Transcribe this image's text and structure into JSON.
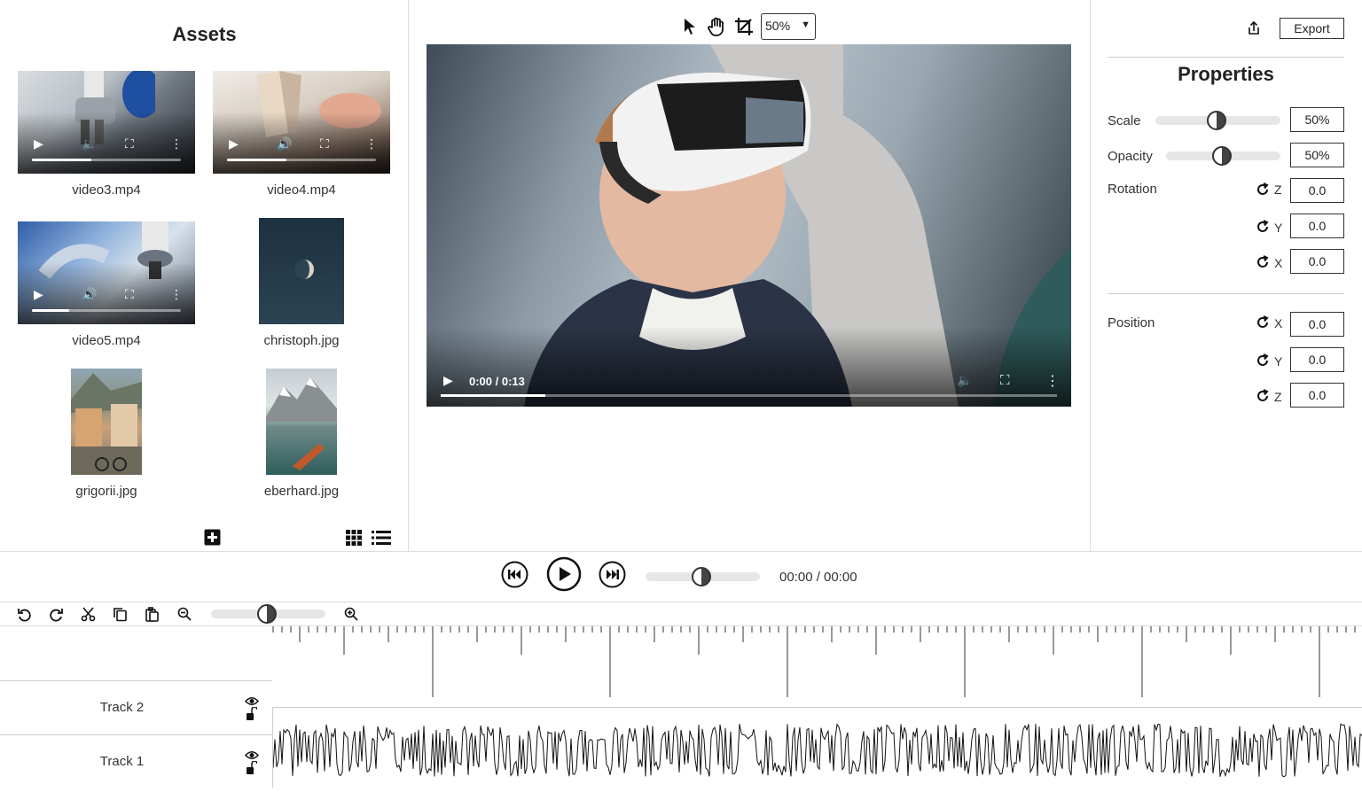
{
  "assets": {
    "title": "Assets",
    "items": [
      {
        "name": "video3.mp4",
        "type": "video",
        "progress": 0.4
      },
      {
        "name": "video4.mp4",
        "type": "video",
        "progress": 0.4
      },
      {
        "name": "video5.mp4",
        "type": "video",
        "progress": 0.25
      },
      {
        "name": "christoph.jpg",
        "type": "image"
      },
      {
        "name": "grigorii.jpg",
        "type": "image"
      },
      {
        "name": "eberhard.jpg",
        "type": "image"
      }
    ],
    "icons": {
      "add": "plus-square-icon",
      "grid": "grid-view-icon",
      "list": "list-view-icon"
    }
  },
  "preview": {
    "tools": [
      "pointer-icon",
      "hand-icon",
      "crop-icon"
    ],
    "zoom": "50%",
    "time": "0:00 / 0:13",
    "progress": 0.17
  },
  "properties": {
    "export_label": "Export",
    "title": "Properties",
    "scale": {
      "label": "Scale",
      "value": "50%"
    },
    "opacity": {
      "label": "Opacity",
      "value": "50%"
    },
    "rotation": {
      "label": "Rotation",
      "z_axis": "Z",
      "y_axis": "Y",
      "x_axis": "X",
      "z": "0.0",
      "y": "0.0",
      "x": "0.0"
    },
    "position": {
      "label": "Position",
      "x_axis": "X",
      "y_axis": "Y",
      "z_axis": "Z",
      "x": "0.0",
      "y": "0.0",
      "z": "0.0"
    }
  },
  "transport": {
    "time": "00:00 / 00:00"
  },
  "timeline": {
    "tools": [
      "undo-icon",
      "redo-icon",
      "cut-icon",
      "copy-icon",
      "paste-icon",
      "zoom-out-icon",
      "zoom-in-icon"
    ],
    "tracks": [
      {
        "name": "Track 2"
      },
      {
        "name": "Track 1"
      }
    ]
  }
}
